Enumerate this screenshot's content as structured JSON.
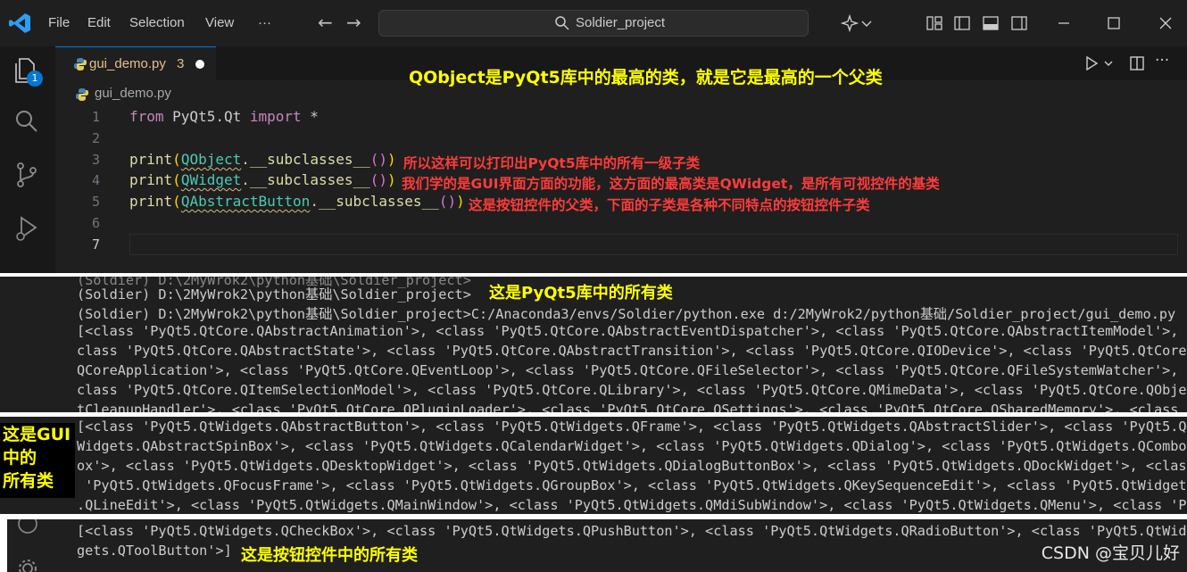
{
  "menu": {
    "file": "File",
    "edit": "Edit",
    "selection": "Selection",
    "view": "View",
    "more": "···"
  },
  "command_center": {
    "text": "Soldier_project"
  },
  "activity": {
    "badge": "1"
  },
  "tab": {
    "label": "gui_demo.py",
    "problems": "3"
  },
  "breadcrumb": "gui_demo.py",
  "code": {
    "line_numbers": [
      "1",
      "2",
      "3",
      "4",
      "5",
      "6",
      "7"
    ],
    "l1_from": "from",
    "l1_mod": " PyQt5.Qt ",
    "l1_import": "import",
    "l1_star": " *",
    "print": "print",
    "open": "(",
    "close": ")",
    "qobject": "QObject",
    "qwidget": "QWidget",
    "qabstractbutton": "QAbstractButton",
    "dot_sub": ".",
    "subclasses": "__subclasses__",
    "call": "()"
  },
  "annotations": {
    "header": "QObject是PyQt5库中的最高的类，就是它是最高的一个父类",
    "line3": "所以这样可以打印出PyQt5库中的所有一级子类",
    "line4": "我们学的是GUI界面方面的功能，这方面的最高类是QWidget，是所有可视控件的基类",
    "line5": "这是按钮控件的父类，下面的子类是各种不同特点的按钮控件子类",
    "all_pyqt5": "这是PyQt5库中的所有类",
    "gui_all_1": "这是GUI",
    "gui_all_2": "中的",
    "gui_all_3": "所有类",
    "buttons_all": "这是按钮控件中的所有类"
  },
  "terminal1": [
    "(Soldier) D:\\2MyWrok2\\python基础\\Soldier_project>",
    "(Soldier) D:\\2MyWrok2\\python基础\\Soldier_project>C:/Anaconda3/envs/Soldier/python.exe d:/2MyWrok2/python基础/Soldier_project/gui_demo.py",
    "[<class 'PyQt5.QtCore.QAbstractAnimation'>, <class 'PyQt5.QtCore.QAbstractEventDispatcher'>, <class 'PyQt5.QtCore.QAbstractItemModel'>, <",
    "class 'PyQt5.QtCore.QAbstractState'>, <class 'PyQt5.QtCore.QAbstractTransition'>, <class 'PyQt5.QtCore.QIODevice'>, <class 'PyQt5.QtCore.",
    "QCoreApplication'>, <class 'PyQt5.QtCore.QEventLoop'>, <class 'PyQt5.QtCore.QFileSelector'>, <class 'PyQt5.QtCore.QFileSystemWatcher'>, <",
    "class 'PyQt5.QtCore.QItemSelectionModel'>, <class 'PyQt5.QtCore.QLibrary'>, <class 'PyQt5.QtCore.QMimeData'>, <class 'PyQt5.QtCore.QObjec",
    "tCleanupHandler'>, <class 'PyQt5.QtCore.QPluginLoader'>, <class 'PyQt5.QtCore.QSettings'>, <class 'PyQt5.QtCore.QSharedMemory'>, <class '"
  ],
  "terminal2": [
    "[<class 'PyQt5.QtWidgets.QAbstractButton'>, <class 'PyQt5.QtWidgets.QFrame'>, <class 'PyQt5.QtWidgets.QAbstractSlider'>, <class 'PyQt5.Qt",
    "Widgets.QAbstractSpinBox'>, <class 'PyQt5.QtWidgets.QCalendarWidget'>, <class 'PyQt5.QtWidgets.QDialog'>, <class 'PyQt5.QtWidgets.QComboB",
    "ox'>, <class 'PyQt5.QtWidgets.QDesktopWidget'>, <class 'PyQt5.QtWidgets.QDialogButtonBox'>, <class 'PyQt5.QtWidgets.QDockWidget'>, <class",
    " 'PyQt5.QtWidgets.QFocusFrame'>, <class 'PyQt5.QtWidgets.QGroupBox'>, <class 'PyQt5.QtWidgets.QKeySequenceEdit'>, <class 'PyQt5.QtWidgets",
    ".QLineEdit'>, <class 'PyQt5.QtWidgets.QMainWindow'>, <class 'PyQt5.QtWidgets.QMdiSubWindow'>, <class 'PyQt5.QtWidgets.QMenu'>, <class 'Py"
  ],
  "terminal3": [
    "[<class 'PyQt5.QtWidgets.QCheckBox'>, <class 'PyQt5.QtWidgets.QPushButton'>, <class 'PyQt5.QtWidgets.QRadioButton'>, <class 'PyQt5.QtWid",
    "gets.QToolButton'>]"
  ],
  "watermark": "CSDN @宝贝儿好",
  "colors": {
    "accent": "#0078d4",
    "annotation_yellow": "#ffff00",
    "annotation_red": "#ff3b3b",
    "background": "#1f1f1f"
  }
}
